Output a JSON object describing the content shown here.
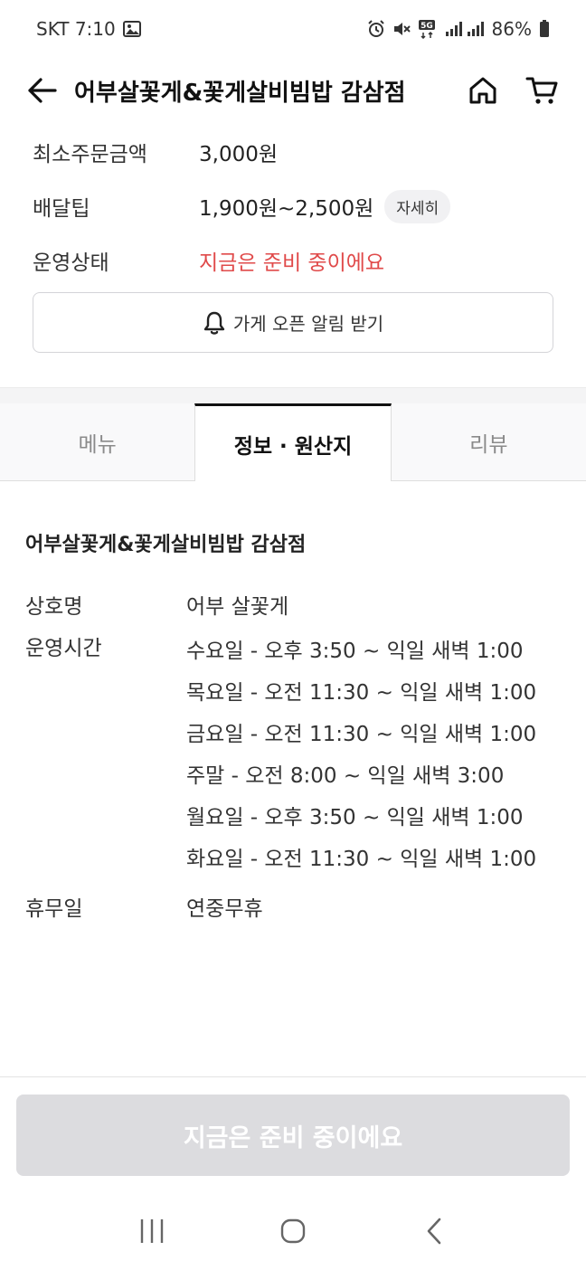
{
  "status_bar": {
    "carrier_time": "SKT 7:10",
    "battery": "86%",
    "icons": [
      "image-icon",
      "alarm-icon",
      "mute-icon",
      "5g-icon",
      "signal-icon",
      "battery-icon"
    ]
  },
  "header": {
    "title": "어부살꽃게&꽃게살비빔밥 감삼점",
    "icons": [
      "back-arrow-icon",
      "home-icon",
      "cart-icon"
    ]
  },
  "summary": {
    "min_order_label": "최소주문금액",
    "min_order_value": "3,000원",
    "delivery_tip_label": "배달팁",
    "delivery_tip_value": "1,900원~2,500원",
    "detail_badge": "자세히",
    "status_label": "운영상태",
    "status_value": "지금은 준비 중이에요",
    "status_color": "#e04a4a"
  },
  "notify_button": {
    "label": "가게 오픈 알림 받기",
    "icon": "bell-icon"
  },
  "tabs": [
    {
      "label": "메뉴",
      "active": false
    },
    {
      "label": "정보 · 원산지",
      "active": true
    },
    {
      "label": "리뷰",
      "active": false
    }
  ],
  "info": {
    "store_name": "어부살꽃게&꽃게살비빔밥 감삼점",
    "business_name_label": "상호명",
    "business_name_value": "어부 살꽃게",
    "hours_label": "운영시간",
    "hours": [
      "수요일 - 오후 3:50 ~ 익일 새벽 1:00",
      "목요일 - 오전 11:30 ~ 익일 새벽 1:00",
      "금요일 - 오전 11:30 ~ 익일 새벽 1:00",
      "주말 - 오전 8:00 ~ 익일 새벽 3:00",
      "월요일 - 오후 3:50 ~ 익일 새벽 1:00",
      "화요일 - 오전 11:30 ~ 익일 새벽 1:00"
    ],
    "closed_label": "휴무일",
    "closed_value": "연중무휴"
  },
  "cta": {
    "label": "지금은 준비 중이에요",
    "background": "#dcdcdf"
  },
  "nav_bar": {
    "icons": [
      "recent-apps-icon",
      "home-button-icon",
      "back-button-icon"
    ]
  }
}
